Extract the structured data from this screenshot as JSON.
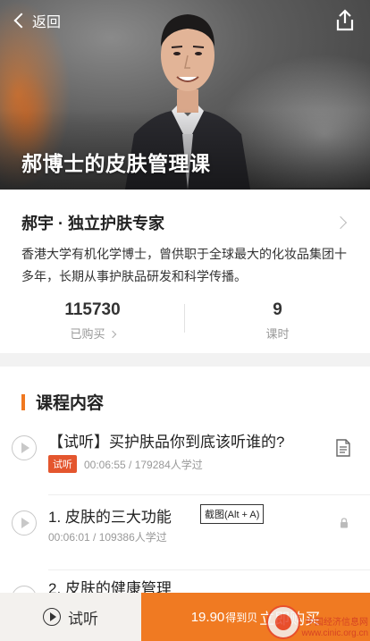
{
  "header": {
    "back_label": "返回",
    "course_title": "郝博士的皮肤管理课"
  },
  "author": {
    "name": "郝宇 · 独立护肤专家",
    "bio": "香港大学有机化学博士，曾供职于全球最大的化妆品集团十多年，长期从事护肤品研发和科学传播。",
    "stats": {
      "purchased_count": "115730",
      "purchased_label": "已购买",
      "lessons_count": "9",
      "lessons_label": "课时"
    }
  },
  "course": {
    "section_title": "课程内容",
    "lessons": [
      {
        "title": "【试听】买护肤品你到底该听谁的?",
        "badge": "试听",
        "meta": "00:06:55 / 179284人学过",
        "icon": "document-icon"
      },
      {
        "title": "1. 皮肤的三大功能",
        "meta": "00:06:01 / 109386人学过",
        "tooltip": "截图(Alt + A)",
        "icon": "lock-icon"
      },
      {
        "title": "2. 皮肤的健康管理"
      }
    ]
  },
  "bottom_bar": {
    "trial_label": "试听",
    "price": "19.90",
    "price_unit": "得到贝",
    "action": "立即购买"
  },
  "watermark": {
    "text_top": "中国经济信息网",
    "text_bottom": "www.cinic.org.cn"
  },
  "colors": {
    "accent": "#f07a22",
    "badge": "#e4562e"
  }
}
